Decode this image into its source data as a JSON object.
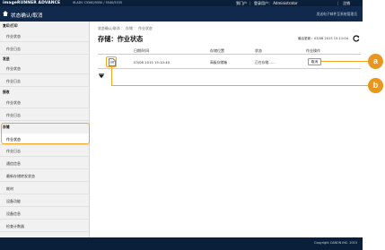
{
  "header": {
    "brand": "imageRUNNER ADVANCE",
    "device_name": "iR-ADV C5560/5550 / 5540/5535",
    "portal_link": "到门户",
    "login_user_label": "登录用户： Administrator",
    "logout_link": "注销",
    "subtitle": "状态确认/取消",
    "mail_link": "发送电子邮件至系统管理员"
  },
  "sidebar": {
    "categories": [
      "复印/打印",
      "发送",
      "接收",
      "存储"
    ],
    "items": [
      "作业状态",
      "作业日志",
      "作业状态",
      "作业日志",
      "作业状态",
      "作业日志",
      "作业状态",
      "作业日志",
      "通信信息",
      "最新存储转发状态",
      "耗材",
      "设备功能",
      "设备信息",
      "检查计数器"
    ]
  },
  "main": {
    "breadcrumb": "状态确认/取消 ： 存储 ： 作业状态",
    "title": "存储：作业状态",
    "last_update": "最后更新：03/08 2015 15:11:04",
    "columns": [
      "日期/时间",
      "存储位置",
      "状态",
      "作业操作"
    ],
    "row": {
      "datetime": "03/08 2015 15:10:40",
      "location": "高级存储箱",
      "status": "正在存储……",
      "action_label": "取消"
    }
  },
  "callouts": {
    "a": "a",
    "b": "b"
  },
  "footer": {
    "copyright": "Copyright CANON INC. 2015"
  },
  "colors": {
    "header_bg": "#0a1f3a",
    "accent": "#f5a623",
    "callout": "#e8961e"
  },
  "icons": {
    "home": "home-icon",
    "refresh": "refresh-icon",
    "document": "document-icon",
    "pager": "pager-icon"
  }
}
